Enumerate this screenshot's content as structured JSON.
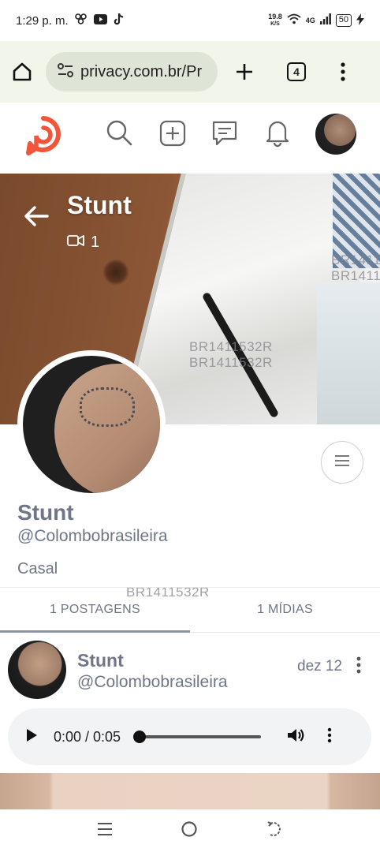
{
  "status_bar": {
    "time": "1:29 p. m.",
    "net_speed_value": "19.8",
    "net_speed_unit": "K/S",
    "signal_label": "4G",
    "battery": "50"
  },
  "browser": {
    "url": "privacy.com.br/Pr",
    "tab_count": "4"
  },
  "app_header": {
    "icons": [
      "logo-icon",
      "search-icon",
      "add-icon",
      "messages-icon",
      "bell-icon",
      "avatar"
    ]
  },
  "cover": {
    "title": "Stunt",
    "video_count": "1",
    "watermark": "BR1411532R"
  },
  "profile": {
    "name": "Stunt",
    "handle": "@Colombobrasileira",
    "bio": "Casal"
  },
  "tabs": [
    {
      "label": "1 POSTAGENS",
      "active": true
    },
    {
      "label": "1 MÍDIAS",
      "active": false
    }
  ],
  "post": {
    "name": "Stunt",
    "handle": "@Colombobrasileira",
    "date": "dez 12",
    "audio": {
      "time": "0:00 / 0:05",
      "progress": 0
    }
  },
  "colors": {
    "accent": "#f2553a",
    "muted_text": "#6f7687"
  }
}
